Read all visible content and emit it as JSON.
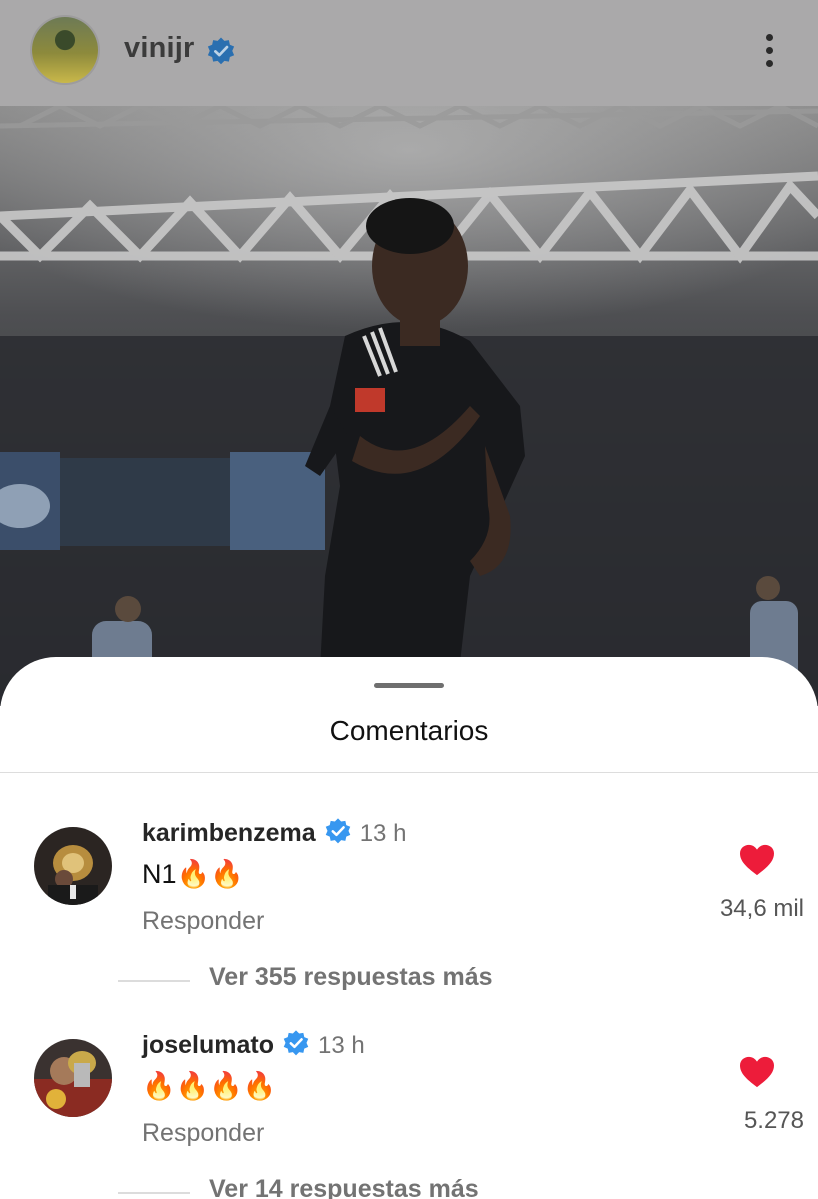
{
  "header": {
    "username": "vinijr",
    "verified": true,
    "menu_icon": "more-vertical-icon"
  },
  "sheet": {
    "title": "Comentarios"
  },
  "comments": [
    {
      "username": "karimbenzema",
      "verified": true,
      "time": "13 h",
      "text": "N1🔥🔥",
      "reply_label": "Responder",
      "likes": "34,6 mil",
      "view_replies": "Ver 355 respuestas más"
    },
    {
      "username": "joselumato",
      "verified": true,
      "time": "13 h",
      "text": "🔥🔥🔥🔥",
      "reply_label": "Responder",
      "likes": "5.278",
      "view_replies": "Ver 14 respuestas más"
    }
  ],
  "colors": {
    "verified_blue": "#3797f0",
    "like_red": "#ed1c3a",
    "overlay_gray": "#aaa9aa"
  }
}
